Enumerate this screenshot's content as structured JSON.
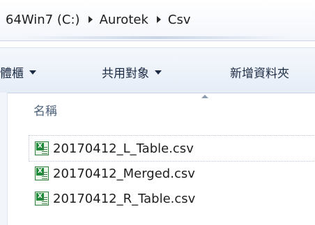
{
  "address_bar": {
    "crumbs": [
      "64Win7 (C:)",
      "Aurotek",
      "Csv"
    ]
  },
  "toolbar": {
    "items": [
      "體櫃",
      "共用對象",
      "新增資料夾"
    ]
  },
  "file_list": {
    "column_header": "名稱",
    "files": [
      "20170412_L_Table.csv",
      "20170412_Merged.csv",
      "20170412_R_Table.csv"
    ]
  }
}
